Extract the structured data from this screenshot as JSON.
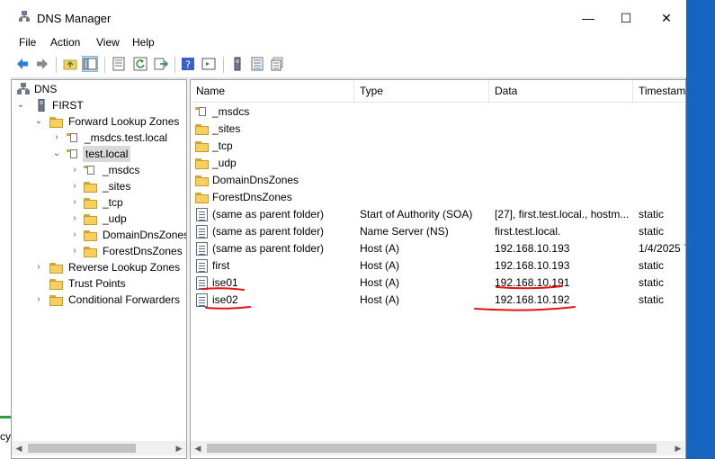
{
  "window": {
    "title": "DNS Manager",
    "minimize": "—",
    "maximize": "☐",
    "close": "✕"
  },
  "background": {
    "left_text": "cy"
  },
  "menu": [
    "File",
    "Action",
    "View",
    "Help"
  ],
  "tree": {
    "root": "DNS",
    "server": "FIRST",
    "forward": "Forward Lookup Zones",
    "msdcs_zone": "_msdcs.test.local",
    "test_zone": "test.local",
    "children": [
      "_msdcs",
      "_sites",
      "_tcp",
      "_udp",
      "DomainDnsZones",
      "ForestDnsZones"
    ],
    "reverse": "Reverse Lookup Zones",
    "trust": "Trust Points",
    "conditional": "Conditional Forwarders"
  },
  "list": {
    "columns": [
      "Name",
      "Type",
      "Data",
      "Timestam"
    ],
    "folders": [
      "_msdcs",
      "_sites",
      "_tcp",
      "_udp",
      "DomainDnsZones",
      "ForestDnsZones"
    ],
    "records": [
      {
        "name": "(same as parent folder)",
        "type": "Start of Authority (SOA)",
        "data": "[27], first.test.local., hostm...",
        "timestamp": "static"
      },
      {
        "name": "(same as parent folder)",
        "type": "Name Server (NS)",
        "data": "first.test.local.",
        "timestamp": "static"
      },
      {
        "name": "(same as parent folder)",
        "type": "Host (A)",
        "data": "192.168.10.193",
        "timestamp": "1/4/2025 7"
      },
      {
        "name": "first",
        "type": "Host (A)",
        "data": "192.168.10.193",
        "timestamp": "static"
      },
      {
        "name": "ise01",
        "type": "Host (A)",
        "data": "192.168.10.191",
        "timestamp": "static"
      },
      {
        "name": "ise02",
        "type": "Host (A)",
        "data": "192.168.10.192",
        "timestamp": "static"
      }
    ]
  },
  "colors": {
    "selection": "#d9d9d9",
    "annotation": "#e81010",
    "desktop_accent": "#1565c0"
  }
}
